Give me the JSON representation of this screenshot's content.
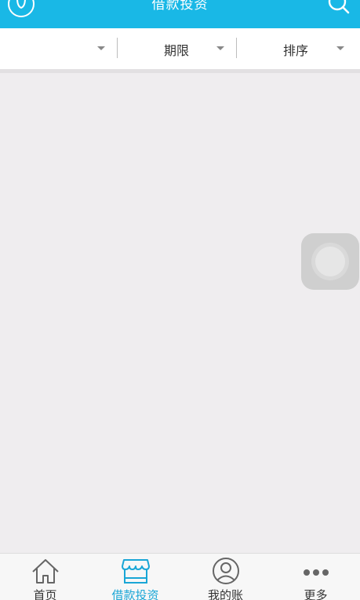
{
  "colors": {
    "accent": "#19b8e6",
    "tab_active": "#19a6d6",
    "background": "#efedef"
  },
  "header": {
    "title": "借款投资",
    "left_icon": "user-circle-icon",
    "right_icon": "search-icon"
  },
  "filters": [
    {
      "label": ""
    },
    {
      "label": "期限"
    },
    {
      "label": "排序"
    }
  ],
  "tabbar": {
    "items": [
      {
        "label": "首页",
        "icon": "home-icon",
        "active": false
      },
      {
        "label": "借款投资",
        "icon": "shop-icon",
        "active": true
      },
      {
        "label": "我的账",
        "icon": "account-icon",
        "active": false
      },
      {
        "label": "更多",
        "icon": "more-dots-icon",
        "active": false
      }
    ]
  }
}
